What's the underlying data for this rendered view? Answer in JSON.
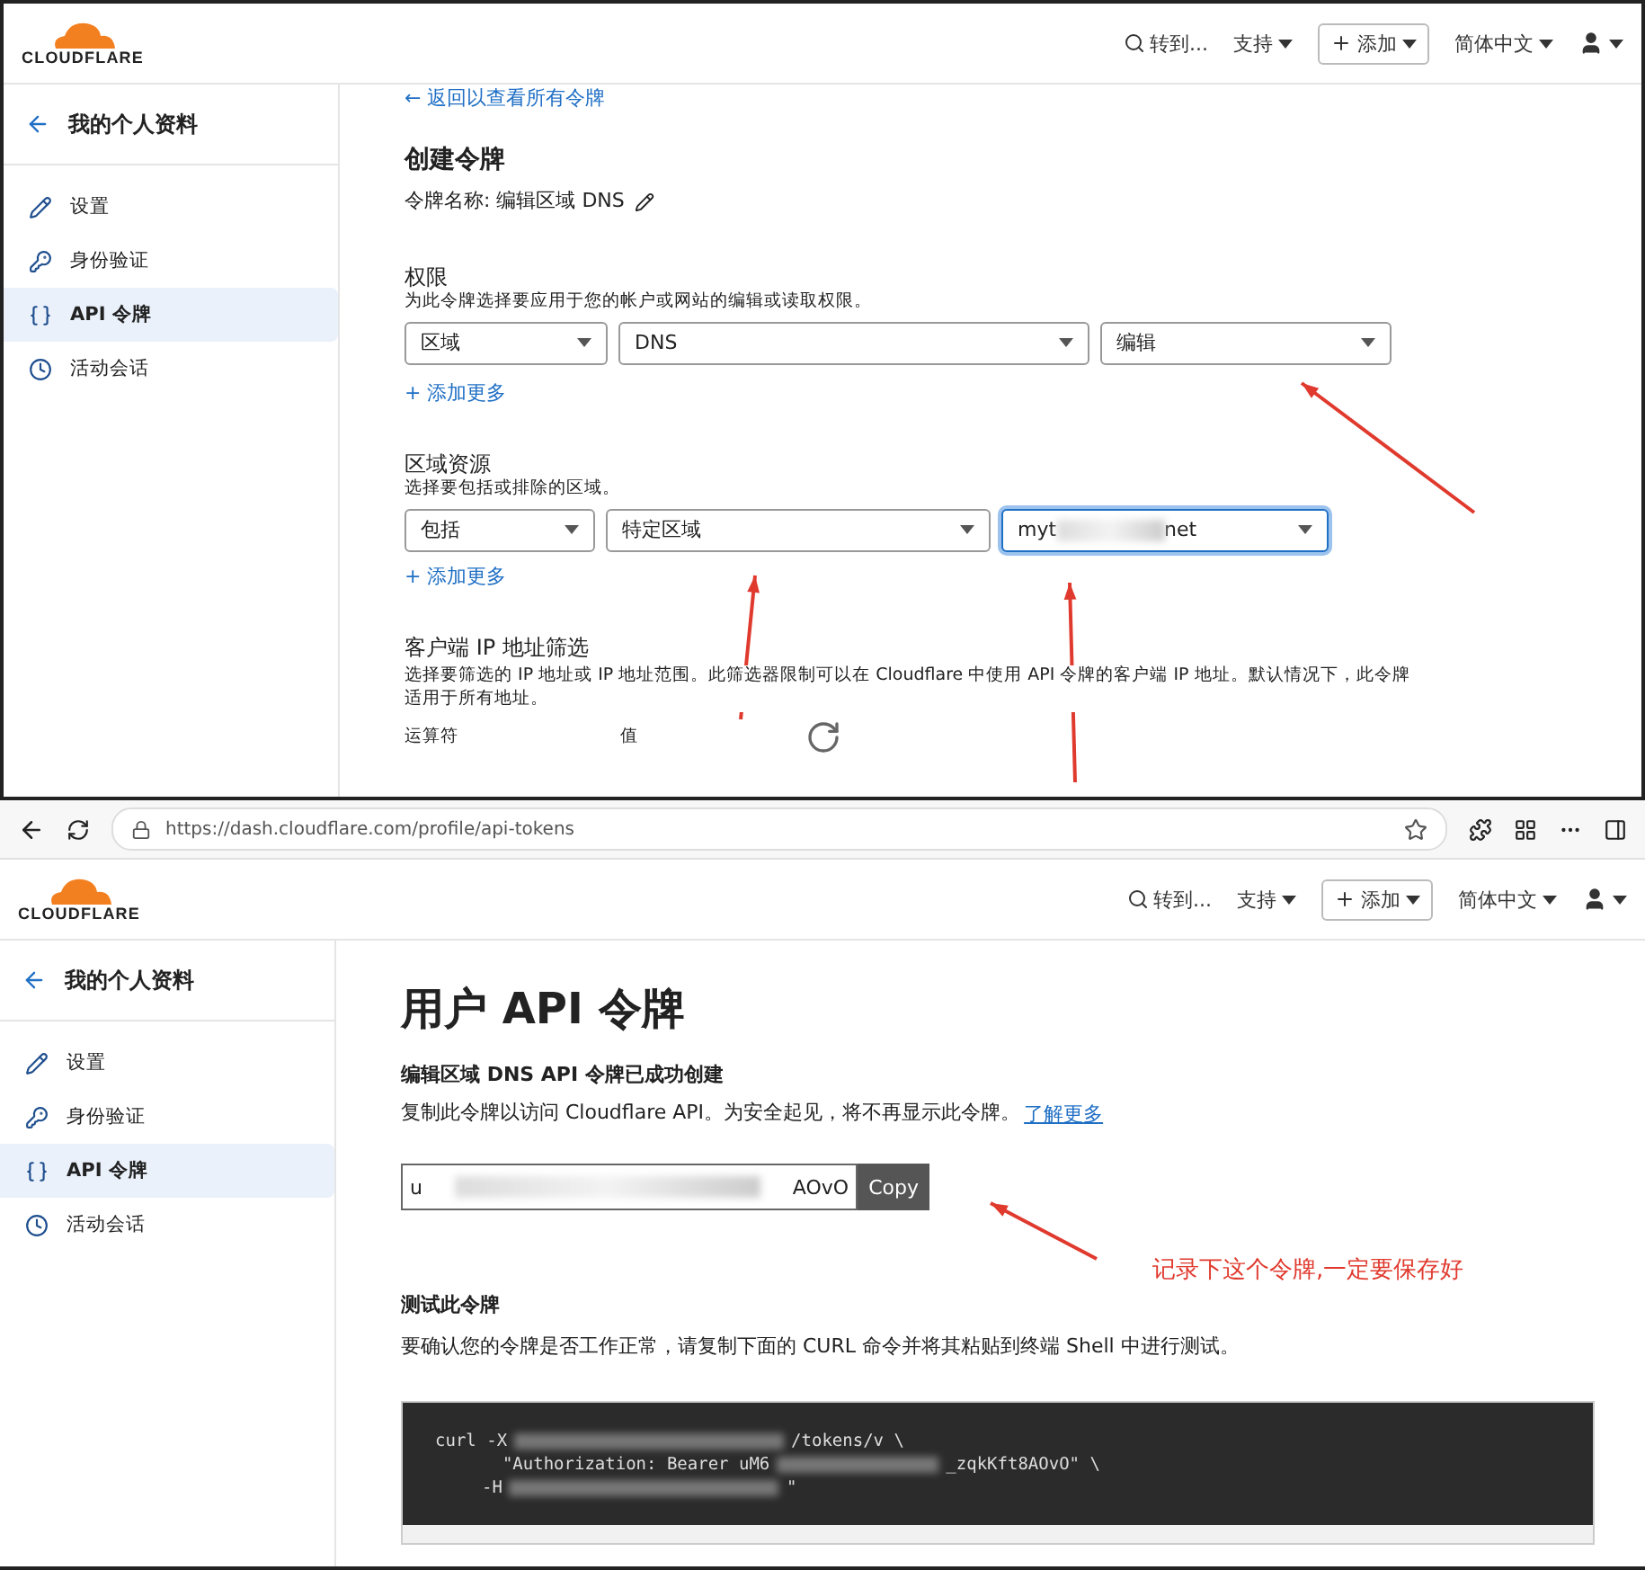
{
  "top_panel": {
    "header": {
      "logo": "CLOUDFLARE",
      "nav": [
        {
          "kind": "search",
          "label": "转到..."
        },
        {
          "kind": "menu",
          "label": "支持"
        },
        {
          "kind": "add",
          "label": "添加"
        },
        {
          "kind": "menu",
          "label": "简体中文"
        },
        {
          "kind": "user"
        }
      ]
    },
    "sidebar": {
      "title": "我的个人资料",
      "items": [
        {
          "label": "设置",
          "selected": false
        },
        {
          "label": "身份验证",
          "selected": false
        },
        {
          "label": "API 令牌",
          "selected": true
        },
        {
          "label": "活动会话",
          "selected": false
        }
      ]
    },
    "back_link": "← 返回以查看所有令牌",
    "title": "创建令牌",
    "token_name": "令牌名称: 编辑区域 DNS",
    "permissions": {
      "label": "权限",
      "description": "为此令牌选择要应用于您的帐户或网站的编辑或读取权限。",
      "selects": [
        {
          "value": "区域",
          "focused": false
        },
        {
          "value": "DNS",
          "focused": false
        },
        {
          "value": "编辑",
          "focused": false
        }
      ],
      "add_more": "+ 添加更多"
    },
    "zone_resources": {
      "label": "区域资源",
      "description": "选择要包括或排除的区域。",
      "selects": [
        {
          "value": "包括",
          "focused": false
        },
        {
          "value": "特定区域",
          "focused": false
        },
        {
          "value": "myt",
          "value_end": "net",
          "redacted": true,
          "focused": true
        }
      ],
      "add_more": "+ 添加更多"
    },
    "ip_filter": {
      "label": "客户端 IP 地址筛选",
      "description": "选择要筛选的 IP 地址或 IP 地址范围。此筛选器限制可以在 Cloudflare 中使用 API 令牌的客户端 IP 地址。默认情况下，此令牌适用于所有地址。",
      "columns": [
        "运算符",
        "值"
      ]
    }
  },
  "bottom_panel": {
    "browser": {
      "url": "https://dash.cloudflare.com/profile/api-tokens"
    },
    "header": {
      "logo": "CLOUDFLARE",
      "nav": [
        {
          "kind": "search",
          "label": "转到..."
        },
        {
          "kind": "menu",
          "label": "支持"
        },
        {
          "kind": "add",
          "label": "添加"
        },
        {
          "kind": "menu",
          "label": "简体中文"
        },
        {
          "kind": "user"
        }
      ]
    },
    "sidebar": {
      "title": "我的个人资料",
      "items": [
        {
          "label": "设置",
          "selected": false
        },
        {
          "label": "身份验证",
          "selected": false
        },
        {
          "label": "API 令牌",
          "selected": true
        },
        {
          "label": "活动会话",
          "selected": false
        }
      ]
    },
    "title": "用户 API 令牌",
    "success": "编辑区域 DNS API 令牌已成功创建",
    "notice": "复制此令牌以访问 Cloudflare API。为安全起见，将不再显示此令牌。",
    "learn_more": "了解更多",
    "token": {
      "start": "u",
      "end": "AOvO",
      "copy": "Copy"
    },
    "test": {
      "title": "测试此令牌",
      "description": "要确认您的令牌是否工作正常，请复制下面的 CURL 命令并将其粘贴到终端 Shell 中进行测试。",
      "code_lines": [
        {
          "start": "curl -X",
          "end": "/tokens/v \\"
        },
        {
          "start": "  \"Authorization: Bearer uM6",
          "end": "_zqkKft8AOvO\" \\"
        },
        {
          "start": "-H",
          "end": "\""
        }
      ]
    }
  },
  "annotation": {
    "note": "记录下这个令牌,一定要保存好"
  }
}
